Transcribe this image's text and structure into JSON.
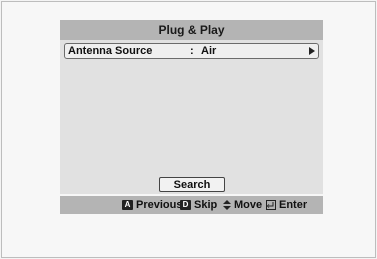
{
  "dialog": {
    "title": "Plug & Play",
    "setting": {
      "label": "Antenna Source",
      "separator": ":",
      "value": "Air"
    },
    "search_button": "Search"
  },
  "footer": {
    "hints": [
      {
        "key": "A",
        "label": "Previous"
      },
      {
        "key": "D",
        "label": "Skip"
      },
      {
        "label": "Move"
      },
      {
        "label": "Enter"
      }
    ]
  },
  "icons": {
    "arrow": "right-arrow-icon",
    "move": "up-down-arrows-icon",
    "enter": "enter-icon"
  }
}
